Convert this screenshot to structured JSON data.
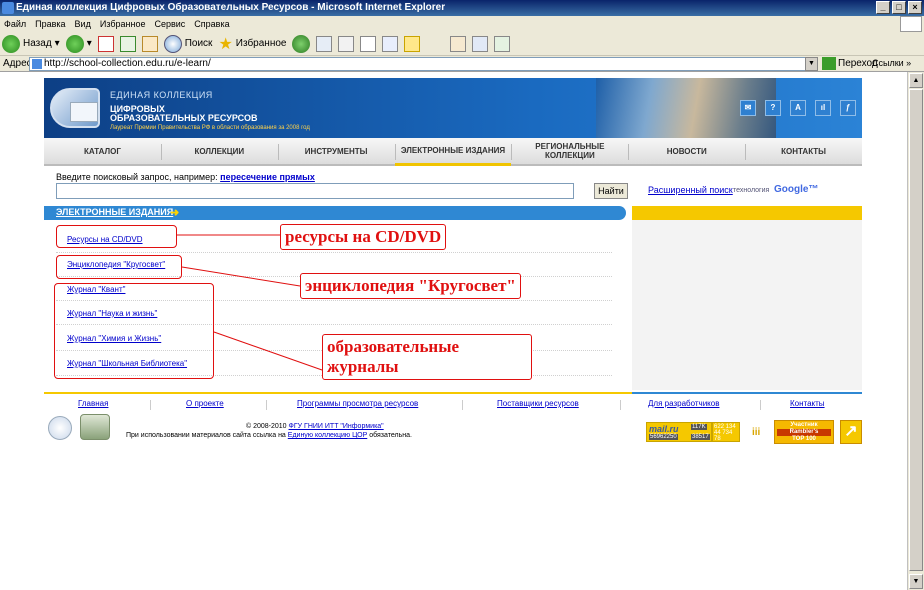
{
  "window": {
    "title": "Единая коллекция Цифровых Образовательных Ресурсов - Microsoft Internet Explorer",
    "buttons": [
      "_",
      "□",
      "×"
    ]
  },
  "menu": [
    "Файл",
    "Правка",
    "Вид",
    "Избранное",
    "Сервис",
    "Справка"
  ],
  "toolbar": {
    "back": "Назад",
    "search": "Поиск",
    "favorites": "Избранное"
  },
  "address": {
    "label": "Адрес:",
    "url": "http://school-collection.edu.ru/e-learn/",
    "go": "Переход",
    "links": "Ссылки »"
  },
  "site": {
    "logo": {
      "line1": "ЕДИНАЯ КОЛЛЕКЦИЯ",
      "line2": "ЦИФРОВЫХ",
      "line3": "ОБРАЗОВАТЕЛЬНЫХ РЕСУРСОВ",
      "line4": "Лауреат Премии Правительства РФ в области образования за 2008 год"
    },
    "header_icons": [
      "✉",
      "?",
      "A",
      "ıl",
      "ƒ"
    ],
    "nav": [
      "КАТАЛОГ",
      "КОЛЛЕКЦИИ",
      "ИНСТРУМЕНТЫ",
      "ЭЛЕКТРОННЫЕ ИЗДАНИЯ",
      "РЕГИОНАЛЬНЫЕ КОЛЛЕКЦИИ",
      "НОВОСТИ",
      "КОНТАКТЫ"
    ],
    "search": {
      "label": "Введите поисковый запрос, например:",
      "example": "пересечение прямых",
      "button": "Найти",
      "advanced": "Расширенный поиск",
      "tech": "технология",
      "google": "Google™"
    },
    "section": {
      "title": "ЭЛЕКТРОННЫЕ ИЗДАНИЯ",
      "arrow": "➜",
      "items": [
        "Ресурсы на CD/DVD",
        "Энциклопедия \"Кругосвет\"",
        "Журнал \"Квант\"",
        "Журнал \"Наука и жизнь\"",
        "Журнал \"Химия и Жизнь\"",
        "Журнал \"Школьная Библиотека\""
      ]
    },
    "annotations": {
      "cd": "ресурсы на CD/DVD",
      "enc": "энциклопедия \"Кругосвет\"",
      "journals_1": "образовательные",
      "journals_2": "журналы"
    },
    "footer": {
      "links": [
        "Главная",
        "О проекте",
        "Программы просмотра ресурсов",
        "Поставщики ресурсов",
        "Для разработчиков",
        "Контакты"
      ],
      "copy_prefix": "© 2008-2010",
      "copy_org": "ФГУ ГНИИ ИТТ \"Информика\"",
      "notice_prefix": "При использовании материалов сайта ссылка на",
      "notice_link": "Единую коллекцию ЦОР",
      "notice_suffix": "обязательна."
    },
    "counters": {
      "mail": "mail.ru",
      "mail_n1": "56962250",
      "mail_n2": "117K",
      "mail_n3": "38517",
      "stats": "622 134 44 734 78",
      "rambler_1": "Участник",
      "rambler_2": "Rambler's",
      "rambler_3": "TOP 100"
    }
  }
}
